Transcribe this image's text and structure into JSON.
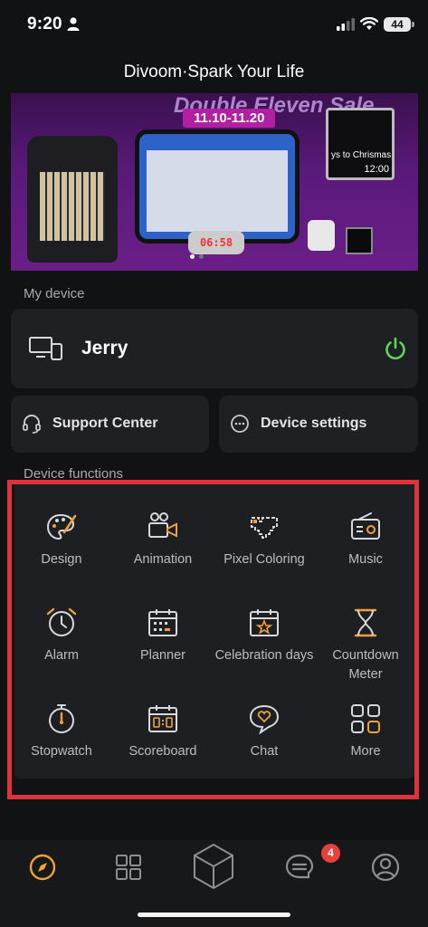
{
  "status_bar": {
    "time": "9:20",
    "battery": "44"
  },
  "app_title": "Divoom·Spark Your Life",
  "banner": {
    "headline": "Double Eleven Sale",
    "date_range": "11.10-11.20",
    "clock_text": "06:58",
    "calendar_text": "ys to Chrismas",
    "calendar_time": "12:00"
  },
  "my_device": {
    "section_label": "My device",
    "device_name": "Jerry"
  },
  "quick_actions": {
    "support_label": "Support Center",
    "settings_label": "Device settings"
  },
  "functions": {
    "section_label": "Device functions",
    "items": [
      {
        "label": "Design",
        "icon": "palette-icon"
      },
      {
        "label": "Animation",
        "icon": "camera-icon"
      },
      {
        "label": "Pixel Coloring",
        "icon": "heart-pixel-icon"
      },
      {
        "label": "Music",
        "icon": "radio-icon"
      },
      {
        "label": "Alarm",
        "icon": "alarm-clock-icon"
      },
      {
        "label": "Planner",
        "icon": "calendar-icon"
      },
      {
        "label": "Celebration days",
        "icon": "calendar-star-icon"
      },
      {
        "label": "Countdown Meter",
        "icon": "hourglass-icon"
      },
      {
        "label": "Stopwatch",
        "icon": "stopwatch-icon"
      },
      {
        "label": "Scoreboard",
        "icon": "scoreboard-icon"
      },
      {
        "label": "Chat",
        "icon": "chat-heart-icon"
      },
      {
        "label": "More",
        "icon": "grid-more-icon"
      }
    ]
  },
  "bottom_nav": {
    "items": [
      "discover-icon",
      "apps-grid-icon",
      "cube-icon",
      "messages-icon",
      "profile-icon"
    ],
    "messages_badge": "4"
  },
  "colors": {
    "accent_orange": "#f0a23a",
    "power_green": "#5fd35a",
    "highlight_red": "#e0323b",
    "badge_red": "#e8413b"
  }
}
